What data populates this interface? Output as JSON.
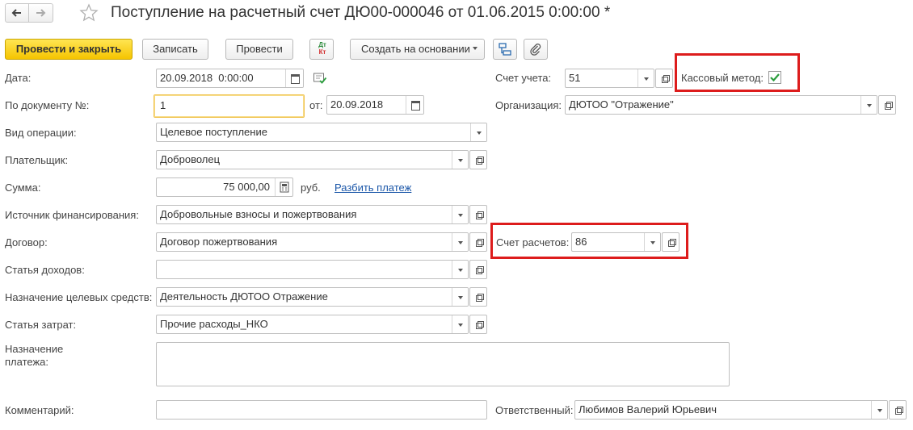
{
  "header": {
    "title": "Поступление на расчетный счет ДЮ00-000046 от 01.06.2015 0:00:00 *"
  },
  "toolbar": {
    "post_close": "Провести и закрыть",
    "save": "Записать",
    "post": "Провести",
    "dtkt_top": "Дт",
    "dtkt_bottom": "Кт",
    "create_based": "Создать на основании"
  },
  "form": {
    "date": {
      "label": "Дата:",
      "value": "20.09.2018  0:00:00"
    },
    "doc_number": {
      "label": "По документу №:",
      "value": "1",
      "from_label": "от:",
      "from_value": "20.09.2018"
    },
    "operation": {
      "label": "Вид операции:",
      "value": "Целевое поступление"
    },
    "payer": {
      "label": "Плательщик:",
      "value": "Доброволец"
    },
    "amount": {
      "label": "Сумма:",
      "value": "75 000,00",
      "currency": "руб.",
      "split_link": "Разбить платеж"
    },
    "funding_source": {
      "label": "Источник финансирования:",
      "value": "Добровольные взносы и пожертвования"
    },
    "contract": {
      "label": "Договор:",
      "value": "Договор пожертвования"
    },
    "income_item": {
      "label": "Статья доходов:",
      "value": ""
    },
    "target_funds": {
      "label": "Назначение целевых средств:",
      "value": "Деятельность ДЮТОО Отражение"
    },
    "expense_item": {
      "label": "Статья затрат:",
      "value": "Прочие расходы_НКО"
    },
    "payment_purpose": {
      "label_line1": "Назначение",
      "label_line2": "платежа:",
      "value": ""
    },
    "comment": {
      "label": "Комментарий:",
      "value": ""
    },
    "account": {
      "label": "Счет учета:",
      "value": "51"
    },
    "cash_method": {
      "label": "Кассовый метод:",
      "checked": true
    },
    "organization": {
      "label": "Организация:",
      "value": "ДЮТОО \"Отражение\""
    },
    "settlement_account": {
      "label": "Счет расчетов:",
      "value": "86"
    },
    "responsible": {
      "label": "Ответственный:",
      "value": "Любимов Валерий Юрьевич"
    }
  },
  "colors": {
    "accent": "#f5c400",
    "highlight": "#dd1c1c",
    "link": "#1a56a8",
    "check": "#2a9d3c"
  }
}
